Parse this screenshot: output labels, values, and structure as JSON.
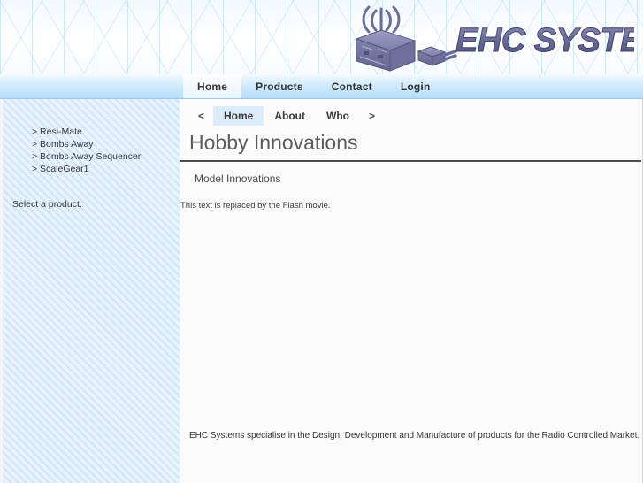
{
  "header": {
    "logo_text": "EHC SYSTEMS",
    "logo_icon": "radio-transmitter-box-icon"
  },
  "mainnav": {
    "items": [
      {
        "label": "Home",
        "active": true
      },
      {
        "label": "Products",
        "active": false
      },
      {
        "label": "Contact",
        "active": false
      },
      {
        "label": "Login",
        "active": false
      }
    ]
  },
  "sidebar": {
    "links": [
      {
        "label": "> Resi-Mate"
      },
      {
        "label": "> Bombs Away"
      },
      {
        "label": "> Bombs Away Sequencer"
      },
      {
        "label": "> ScaleGear1"
      }
    ],
    "note": "Select a product."
  },
  "subnav": {
    "prev_arrow": "<",
    "next_arrow": ">",
    "items": [
      {
        "label": "Home",
        "active": true
      },
      {
        "label": "About",
        "active": false
      },
      {
        "label": "Who",
        "active": false
      }
    ]
  },
  "main": {
    "title": "Hobby Innovations",
    "subtitle": "Model Innovations",
    "flash_placeholder": "This text is replaced by the Flash movie.",
    "tagline": "EHC Systems specialise in the Design, Development and Manufacture of products for the Radio Controlled Market."
  },
  "colors": {
    "nav_blue": "#b3dcf9",
    "sidebar_stripe": "#cfe4f8",
    "active_tab": "#dbedfb",
    "logo_purple": "#6d6f9c",
    "title_gray": "#5b5b5b"
  }
}
